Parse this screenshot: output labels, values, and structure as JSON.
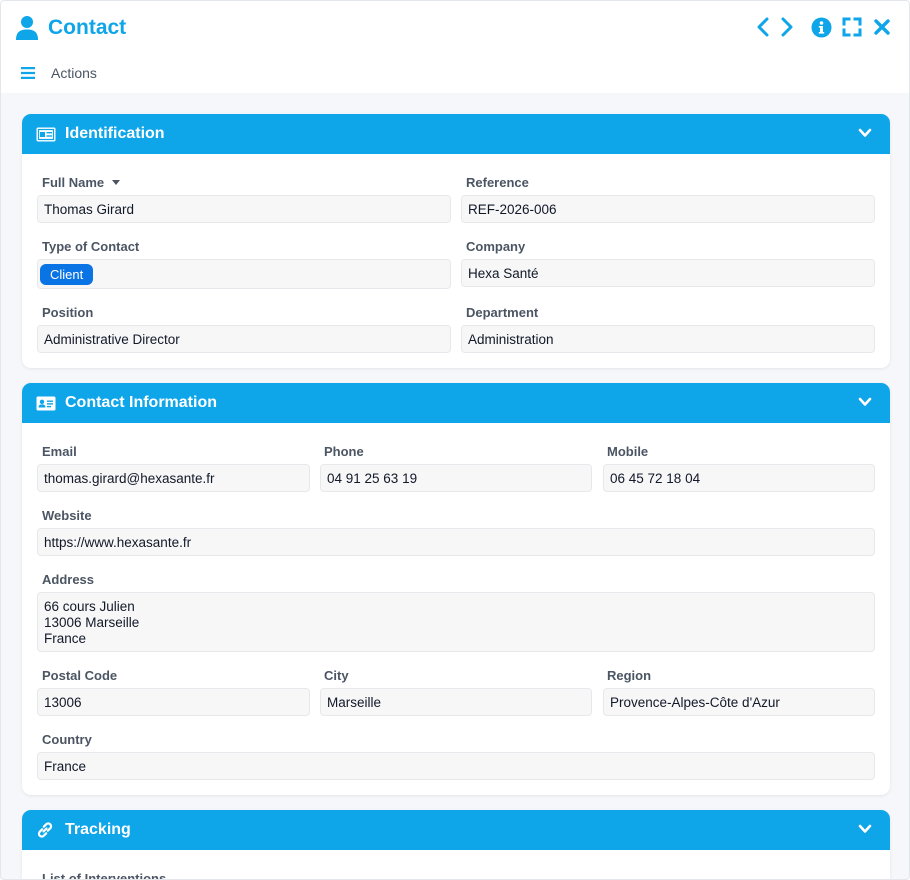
{
  "window": {
    "title": "Contact",
    "actions_label": "Actions"
  },
  "sections": {
    "identification": {
      "title": "Identification",
      "full_name_label": "Full Name",
      "full_name": "Thomas Girard",
      "reference_label": "Reference",
      "reference": "REF-2026-006",
      "type_label": "Type of Contact",
      "type": "Client",
      "company_label": "Company",
      "company": "Hexa Santé",
      "position_label": "Position",
      "position": "Administrative Director",
      "department_label": "Department",
      "department": "Administration"
    },
    "contact_info": {
      "title": "Contact Information",
      "email_label": "Email",
      "email": "thomas.girard@hexasante.fr",
      "phone_label": "Phone",
      "phone": "04 91 25 63 19",
      "mobile_label": "Mobile",
      "mobile": "06 45 72 18 04",
      "website_label": "Website",
      "website": "https://www.hexasante.fr",
      "address_label": "Address",
      "address_lines": [
        "66 cours Julien",
        "13006 Marseille",
        "France"
      ],
      "postal_code_label": "Postal Code",
      "postal_code": "13006",
      "city_label": "City",
      "city": "Marseille",
      "region_label": "Region",
      "region": "Provence-Alpes-Côte d'Azur",
      "country_label": "Country",
      "country": "France"
    },
    "tracking": {
      "title": "Tracking",
      "interventions_label": "List of Interventions"
    }
  },
  "colors": {
    "accent": "#0ea5e9",
    "badge": "#0b74e5",
    "field_bg": "#f7f7f8",
    "label": "#4b5563"
  },
  "icons": {
    "title": "user-icon",
    "prev": "chevron-left-icon",
    "next": "chevron-right-icon",
    "info": "info-icon",
    "fullscreen": "expand-icon",
    "close": "close-icon",
    "menu": "hamburger-menu-icon",
    "identification": "id-card-icon",
    "contact_info": "address-card-icon",
    "tracking": "link-icon",
    "collapse": "chevron-down-icon"
  }
}
